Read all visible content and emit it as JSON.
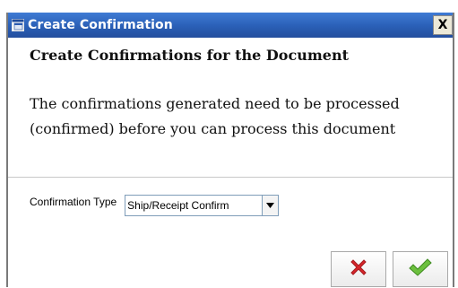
{
  "window": {
    "title": "Create Confirmation",
    "close_glyph": "X"
  },
  "header": {
    "heading": "Create Confirmations for the Document",
    "description": "The confirmations generated need to be processed (confirmed) before you can process this document"
  },
  "form": {
    "confirmation_type_label": "Confirmation Type",
    "confirmation_type_value": "Ship/Receipt Confirm"
  },
  "buttons": {
    "cancel_icon": "red-x-icon",
    "ok_icon": "green-checkmark-icon"
  },
  "colors": {
    "titlebar": "#2a5fb6",
    "cancel": "#d9262b",
    "ok": "#5cb335"
  }
}
